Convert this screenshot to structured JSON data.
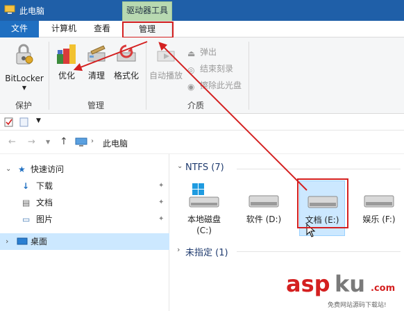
{
  "window": {
    "title": "此电脑",
    "contextual_tab": "驱动器工具"
  },
  "tabs": [
    {
      "label": "文件"
    },
    {
      "label": "计算机"
    },
    {
      "label": "查看"
    },
    {
      "label": "管理"
    }
  ],
  "ribbon": {
    "groups": [
      {
        "label": "保护",
        "buttons": [
          {
            "label": "BitLocker"
          }
        ]
      },
      {
        "label": "管理",
        "buttons": [
          {
            "label": "优化"
          },
          {
            "label": "清理"
          },
          {
            "label": "格式化"
          }
        ]
      },
      {
        "label": "介质",
        "buttons": [
          {
            "label": "自动播放"
          }
        ],
        "small_buttons": [
          {
            "label": "弹出"
          },
          {
            "label": "结束刻录"
          },
          {
            "label": "擦除此光盘"
          }
        ]
      }
    ]
  },
  "address": {
    "path": "此电脑"
  },
  "nav": {
    "quick_access": "快速访问",
    "items": [
      {
        "label": "下载"
      },
      {
        "label": "文档"
      },
      {
        "label": "图片"
      }
    ],
    "desktop": "桌面"
  },
  "content": {
    "ntfs_header": "NTFS (7)",
    "drives": [
      {
        "name": "本地磁盘",
        "letter": "(C:)"
      },
      {
        "name": "软件 (D:)"
      },
      {
        "name": "文档 (E:)"
      },
      {
        "name": "娱乐 (F:)"
      }
    ],
    "unspecified_header": "未指定 (1)"
  },
  "watermark": {
    "brand": "asp",
    "brand2": "ku",
    "suffix": ".com",
    "tagline": "免费网站源码下载站!"
  },
  "colors": {
    "titlebar": "#1f5fa8",
    "file_tab": "#1f6fc1",
    "context_tab": "#b8d9b1",
    "annotation": "#d42020",
    "selection": "#cce8ff"
  }
}
